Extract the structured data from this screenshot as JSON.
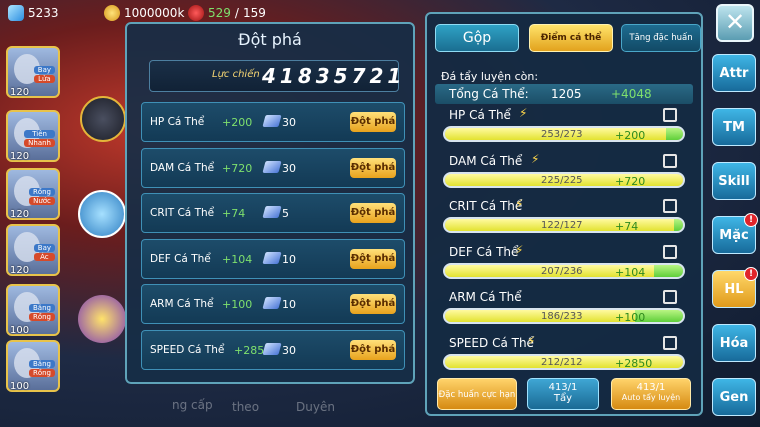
{
  "topbar": {
    "diamonds": "5233",
    "gold": "1000000k",
    "stamina_current": "529",
    "stamina_max": "159"
  },
  "heroes": [
    {
      "level": "120",
      "tags": [
        "Bay",
        "Lửa"
      ]
    },
    {
      "level": "120",
      "tags": [
        "Tiên",
        "Nhanh"
      ]
    },
    {
      "level": "120",
      "tags": [
        "Rồng",
        "Nước"
      ]
    },
    {
      "level": "120",
      "tags": [
        "Bay",
        "Ác"
      ]
    },
    {
      "level": "100",
      "tags": [
        "Băng",
        "Rồng"
      ]
    },
    {
      "level": "100",
      "tags": [
        "Băng",
        "Rồng"
      ]
    }
  ],
  "breakthrough": {
    "title": "Đột phá",
    "power_label": "Lực chiến",
    "power_value": "41835721",
    "rows": [
      {
        "name": "HP Cá Thể",
        "bonus": "+200",
        "cost": "30",
        "button": "Đột phá"
      },
      {
        "name": "DAM Cá Thể",
        "bonus": "+720",
        "cost": "30",
        "button": "Đột phá"
      },
      {
        "name": "CRIT Cá Thể",
        "bonus": "+74",
        "cost": "5",
        "button": "Đột phá"
      },
      {
        "name": "DEF Cá Thể",
        "bonus": "+104",
        "cost": "10",
        "button": "Đột phá"
      },
      {
        "name": "ARM Cá Thể",
        "bonus": "+100",
        "cost": "10",
        "button": "Đột phá"
      },
      {
        "name": "SPEED Cá Thể",
        "bonus": "+2850",
        "cost": "30",
        "button": "Đột phá"
      }
    ]
  },
  "background_labels": {
    "a": "ng cấp",
    "b": "theo",
    "c": "Duyên"
  },
  "right_panel": {
    "tabs": {
      "gop": "Gộp",
      "diem": "Điểm cá thể",
      "tang": "Tăng đặc huấn"
    },
    "remain_label": "Đá tẩy luyện còn:",
    "total_label": "Tổng Cá Thể:",
    "total_value": "1205",
    "total_bonus": "+4048",
    "stats": [
      {
        "name": "HP Cá Thể",
        "current": 253,
        "max": 273,
        "text": "253/273",
        "bonus": "+200",
        "extra_from": 253,
        "extra_to": 273
      },
      {
        "name": "DAM Cá Thể",
        "current": 225,
        "max": 225,
        "text": "225/225",
        "bonus": "+720",
        "extra_from": 225,
        "extra_to": 225
      },
      {
        "name": "CRIT Cá Thể",
        "current": 122,
        "max": 127,
        "text": "122/127",
        "bonus": "+74",
        "extra_from": 122,
        "extra_to": 127
      },
      {
        "name": "DEF Cá Thể",
        "current": 207,
        "max": 236,
        "text": "207/236",
        "bonus": "+104",
        "extra_from": 207,
        "extra_to": 236
      },
      {
        "name": "ARM Cá Thể",
        "current": 186,
        "max": 233,
        "text": "186/233",
        "bonus": "+100",
        "extra_from": 186,
        "extra_to": 233
      },
      {
        "name": "SPEED Cá Thể",
        "current": 212,
        "max": 212,
        "text": "212/212",
        "bonus": "+2850",
        "extra_from": 212,
        "extra_to": 212
      }
    ],
    "buttons": {
      "dac_huan": "Đặc huấn cực hạn",
      "tay_count": "413/1",
      "tay_label": "Tẩy",
      "auto_count": "413/1",
      "auto_label": "Auto tẩy luyện"
    }
  },
  "side_menu": [
    "Attr",
    "TM",
    "Skill",
    "Mặc",
    "HL",
    "Hóa",
    "Gen"
  ],
  "side_badges": {
    "Mặc": "!",
    "HL": "!"
  }
}
